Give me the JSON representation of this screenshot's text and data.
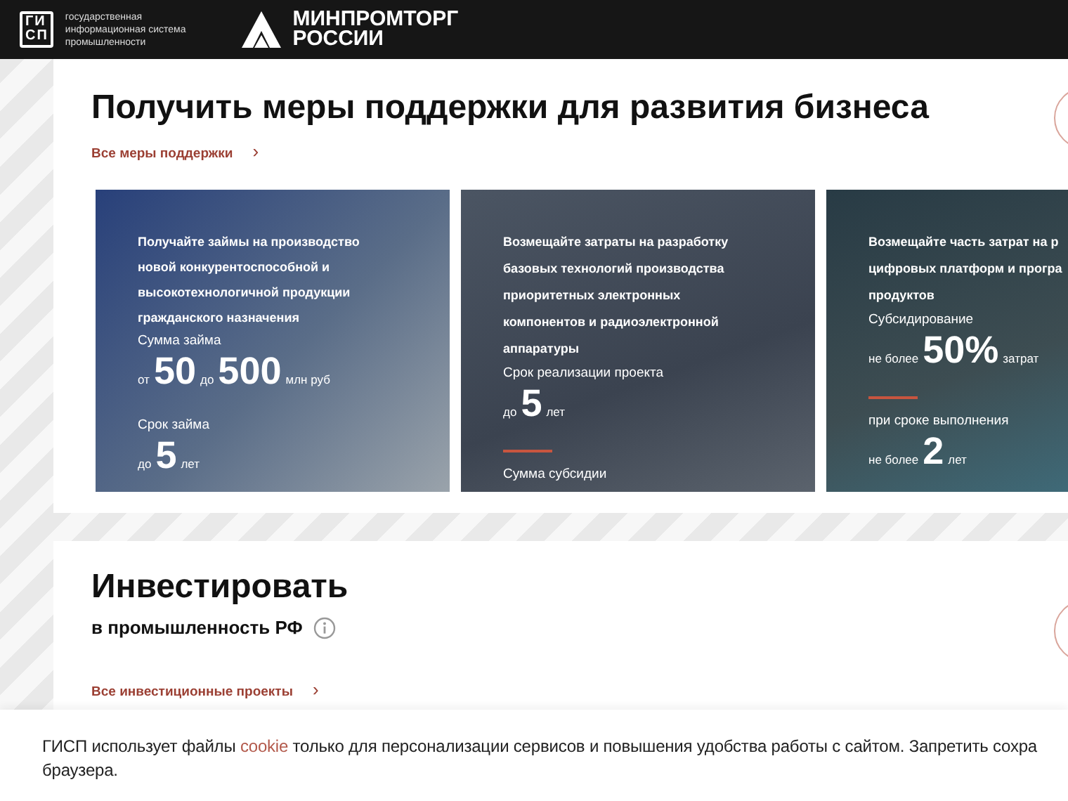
{
  "header": {
    "gisp_logo": {
      "top": "ГИ",
      "bottom": "СП"
    },
    "gisp_caption_lines": [
      "государственная",
      "информационная система",
      "промышленности"
    ],
    "ministry_lines": [
      "МИНПРОМТОРГ",
      "РОССИИ"
    ]
  },
  "support": {
    "title": "Получить меры поддержки для развития бизнеса",
    "link": "Все меры поддержки",
    "chevron": "›",
    "cards": [
      {
        "title_lines": [
          "Получайте займы на производство",
          "новой конкурентоспособной и",
          "высокотехнологичной продукции",
          "гражданского назначения"
        ],
        "divider": false,
        "facts": [
          {
            "label": "Сумма займа",
            "parts": [
              {
                "kind": "small",
                "text": "от"
              },
              {
                "kind": "big",
                "text": "50"
              },
              {
                "kind": "small",
                "text": "до"
              },
              {
                "kind": "big",
                "text": "500"
              },
              {
                "kind": "small",
                "text": "млн руб"
              }
            ]
          },
          {
            "label": "Срок займа",
            "parts": [
              {
                "kind": "small",
                "text": "до"
              },
              {
                "kind": "big",
                "text": "5"
              },
              {
                "kind": "small",
                "text": "лет"
              }
            ]
          }
        ]
      },
      {
        "title_lines": [
          "Возмещайте затраты на разработку",
          "базовых технологий производства",
          "приоритетных электронных",
          "компонентов и радиоэлектронной",
          "аппаратуры"
        ],
        "divider": true,
        "facts": [
          {
            "label": "Срок реализации проекта",
            "parts": [
              {
                "kind": "small",
                "text": "до"
              },
              {
                "kind": "big",
                "text": "5"
              },
              {
                "kind": "small",
                "text": "лет"
              }
            ]
          },
          {
            "label": "Сумма субсидии"
          }
        ]
      },
      {
        "title_lines": [
          "Возмещайте часть затрат на р",
          "цифровых платформ и програ",
          "продуктов"
        ],
        "divider": true,
        "facts": [
          {
            "label": "Субсидирование",
            "parts": [
              {
                "kind": "small",
                "text": "не более"
              },
              {
                "kind": "big",
                "text": "50%"
              },
              {
                "kind": "small",
                "text": "затрат"
              }
            ]
          },
          {
            "label": "при сроке выполнения",
            "parts": [
              {
                "kind": "small",
                "text": "не более"
              },
              {
                "kind": "big",
                "text": "2"
              },
              {
                "kind": "small",
                "text": "лет"
              }
            ]
          }
        ]
      }
    ]
  },
  "invest": {
    "title": "Инвестировать",
    "subtitle": "в промышленность РФ",
    "link": "Все инвестиционные проекты",
    "chevron": "›"
  },
  "cookie_notice": {
    "before_link": "ГИСП использует файлы",
    "link": "cookie",
    "after_link": "только для персонализации сервисов и повышения удобства работы с сайтом. Запретить сохра",
    "line_2": "браузера."
  }
}
